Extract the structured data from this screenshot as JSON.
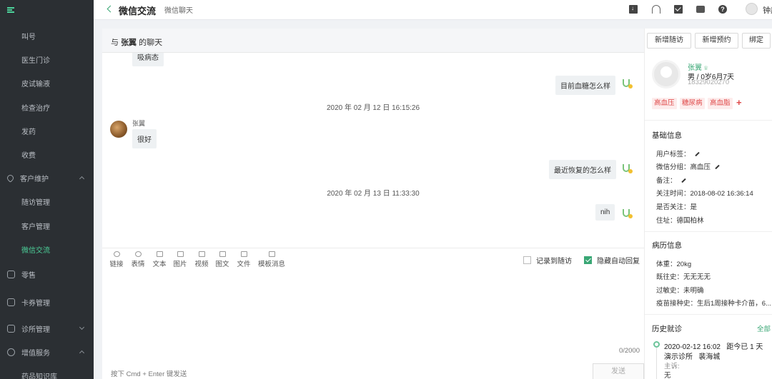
{
  "sidebar": {
    "items": [
      {
        "label": "叫号"
      },
      {
        "label": "医生门诊"
      },
      {
        "label": "皮试输液"
      },
      {
        "label": "检查治疗"
      },
      {
        "label": "发药"
      },
      {
        "label": "收费"
      },
      {
        "label": "客户维护"
      },
      {
        "label": "随访管理"
      },
      {
        "label": "客户管理"
      },
      {
        "label": "微信交流"
      },
      {
        "label": "零售"
      },
      {
        "label": "卡券管理"
      },
      {
        "label": "诊所管理"
      },
      {
        "label": "增值服务"
      },
      {
        "label": "药品知识库"
      }
    ],
    "accent_color": "#4cd19a"
  },
  "topbar": {
    "title": "微信交流",
    "breadcrumb": "微信聊天",
    "user_name": "钟赫"
  },
  "chat": {
    "header_prefix": "与",
    "header_name": "张翼",
    "header_suffix": "的聊天",
    "messages": [
      {
        "side": "left",
        "text": "吸病态"
      },
      {
        "side": "right",
        "text": "目前血糖怎么样"
      },
      {
        "timestamp": "2020 年 02 月 12 日 16:15:26"
      },
      {
        "side": "left",
        "sender": "张翼",
        "text": "很好"
      },
      {
        "side": "right",
        "text": "最近恢复的怎么样"
      },
      {
        "timestamp": "2020 年 02 月 13 日 11:33:30"
      },
      {
        "side": "right",
        "text": "nih"
      }
    ],
    "tools": [
      "链接",
      "表情",
      "文本",
      "图片",
      "视频",
      "图文",
      "文件",
      "模板消息"
    ],
    "checkbox_record": "记录到随访",
    "checkbox_auto_reply": "隐藏自动回复",
    "char_count": "0/2000",
    "send_hint": "按下 Cmd + Enter 键发送",
    "send_label": "发送"
  },
  "profile": {
    "buttons": [
      "新增随访",
      "新增预约",
      "绑定"
    ],
    "name": "张翼",
    "gender_age": "男 / 0岁6月7天",
    "phone": "18329020270",
    "tags": [
      "高血压",
      "糖尿病",
      "高血脂"
    ],
    "tag_add": "+",
    "basic_title": "基础信息",
    "basic": [
      {
        "label": "用户标签：",
        "value": ""
      },
      {
        "label": "微信分组：",
        "value": "高血压"
      },
      {
        "label": "备注：",
        "value": ""
      },
      {
        "label": "关注时间：",
        "value": "2018-08-02 16:36:14"
      },
      {
        "label": "是否关注：",
        "value": "是"
      },
      {
        "label": "住址：",
        "value": "德国柏林"
      }
    ],
    "medical_title": "病历信息",
    "medical": [
      {
        "label": "体重：",
        "value": "20kg"
      },
      {
        "label": "既往史：",
        "value": "无无无无"
      },
      {
        "label": "过敏史：",
        "value": "未明确"
      },
      {
        "label": "疫苗接种史：",
        "value": "生后1周接种卡介苗，6..."
      }
    ],
    "history_title": "历史就诊",
    "history_all": "全部",
    "visit": {
      "datetime": "2020-02-12 16:02",
      "since": "距今已 1 天",
      "clinic": "演示诊所",
      "doctor": "裴海城",
      "complaint_label": "主诉:",
      "complaint_value": "无"
    },
    "accent_color": "#3aa775",
    "tag_color": "#e04a4a"
  }
}
